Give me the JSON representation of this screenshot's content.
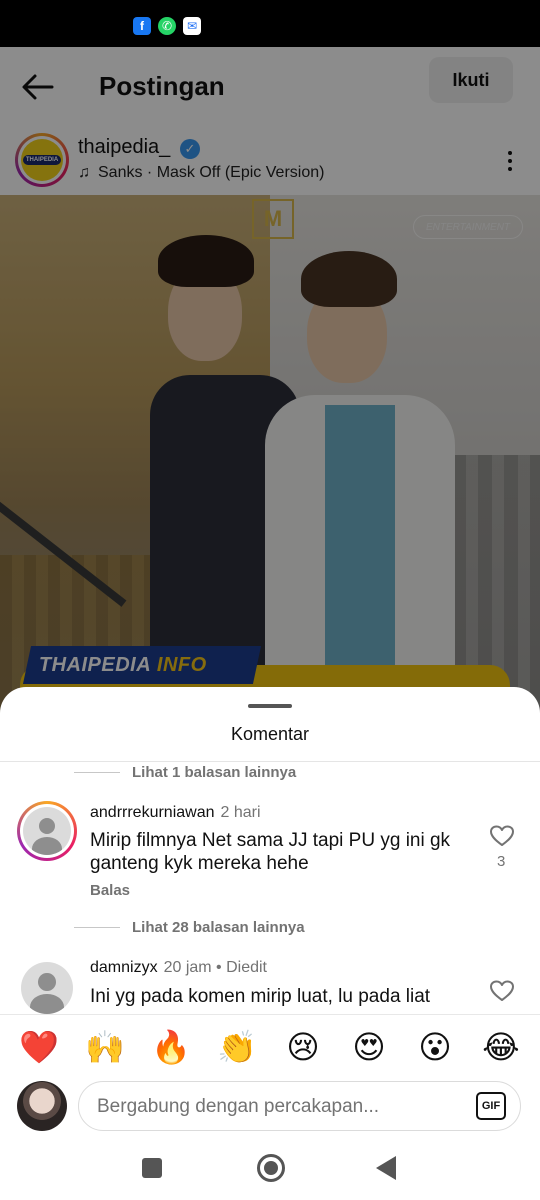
{
  "status_bar": {
    "icons": [
      "facebook-icon",
      "whatsapp-icon",
      "messenger-icon"
    ]
  },
  "header": {
    "title": "Postingan",
    "follow_label": "Ikuti"
  },
  "post": {
    "username": "thaipedia_",
    "verified": true,
    "avatar_logo_text": "THAIPEDIA",
    "music": "Sanks · Mask Off (Epic Version)",
    "image": {
      "watermark": "ENTERTAINMENT",
      "banner_main": "THAIPEDIA",
      "banner_accent": "INFO"
    }
  },
  "comments_sheet": {
    "title": "Komentar",
    "items": [
      {
        "type": "replies_link",
        "label": "Lihat 1 balasan lainnya"
      },
      {
        "type": "comment",
        "username": "andrrrekurniawan",
        "time": "2 hari",
        "text": "Mirip filmnya Net sama JJ tapi PU yg ini gk ganteng kyk mereka hehe",
        "reply_label": "Balas",
        "likes": "3"
      },
      {
        "type": "replies_link",
        "label": "Lihat 28 balasan lainnya"
      },
      {
        "type": "comment",
        "username": "damnizyx",
        "time": "20 jam • Diedit",
        "text": "Ini yg pada komen mirip luat, lu pada liat"
      }
    ]
  },
  "composer": {
    "emojis": [
      "❤️",
      "🙌",
      "🔥",
      "👏",
      "😢",
      "😍",
      "😮",
      "😂"
    ],
    "placeholder": "Bergabung dengan percakapan...",
    "gif_label": "GIF"
  },
  "colors": {
    "accent_blue": "#3897f0",
    "banner_blue": "#1d3d8f",
    "banner_yellow": "#f5c518",
    "muted_text": "#737373"
  }
}
